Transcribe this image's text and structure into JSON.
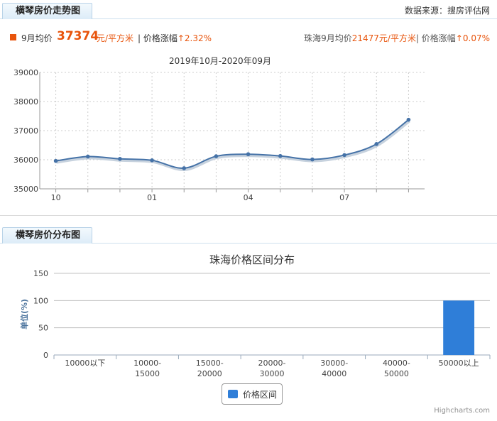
{
  "trend_section": {
    "tab_title": "横琴房价走势图",
    "source": "数据来源：搜房评估网",
    "month_label": "9月均价",
    "price": "37374",
    "unit": "元/平方米",
    "change_label": "| 价格涨幅",
    "change_value": "↑2.32%",
    "city_label": "珠海9月均价",
    "city_price": "21477元/平方米",
    "city_change_label": "| 价格涨幅",
    "city_change_value": "↑0.07%"
  },
  "dist_section": {
    "tab_title": "横琴房价分布图",
    "legend_label": "价格区间",
    "credit": "Highcharts.com"
  },
  "colors": {
    "accent": "#e8540c",
    "line": "#4572a7",
    "bar": "#2f7ed8"
  },
  "chart_data": [
    {
      "type": "line",
      "title": "2019年10月-2020年09月",
      "x": [
        "2019-10",
        "2019-11",
        "2019-12",
        "2020-01",
        "2020-02",
        "2020-03",
        "2020-04",
        "2020-05",
        "2020-06",
        "2020-07",
        "2020-08",
        "2020-09"
      ],
      "tick_labels": [
        "10",
        "01",
        "04",
        "07"
      ],
      "values": [
        35960,
        36110,
        36030,
        35980,
        35710,
        36120,
        36190,
        36130,
        36010,
        36160,
        36540,
        37374
      ],
      "ylim": [
        35000,
        39000
      ],
      "yticks": [
        35000,
        36000,
        37000,
        38000,
        39000
      ],
      "grid": true
    },
    {
      "type": "bar",
      "title": "珠海价格区间分布",
      "ylabel": "单位(%)",
      "categories": [
        "10000以下",
        "10000-15000",
        "15000-20000",
        "20000-30000",
        "30000-40000",
        "40000-50000",
        "50000以上"
      ],
      "category_lines": [
        [
          "10000以下"
        ],
        [
          "10000-",
          "15000"
        ],
        [
          "15000-",
          "20000"
        ],
        [
          "20000-",
          "30000"
        ],
        [
          "30000-",
          "40000"
        ],
        [
          "40000-",
          "50000"
        ],
        [
          "50000以上"
        ]
      ],
      "series": [
        {
          "name": "价格区间",
          "values": [
            0,
            0,
            0,
            0,
            0,
            0,
            100
          ]
        }
      ],
      "ylim": [
        0,
        150
      ],
      "yticks": [
        0,
        50,
        100,
        150
      ],
      "legend": "bottom-center"
    }
  ]
}
